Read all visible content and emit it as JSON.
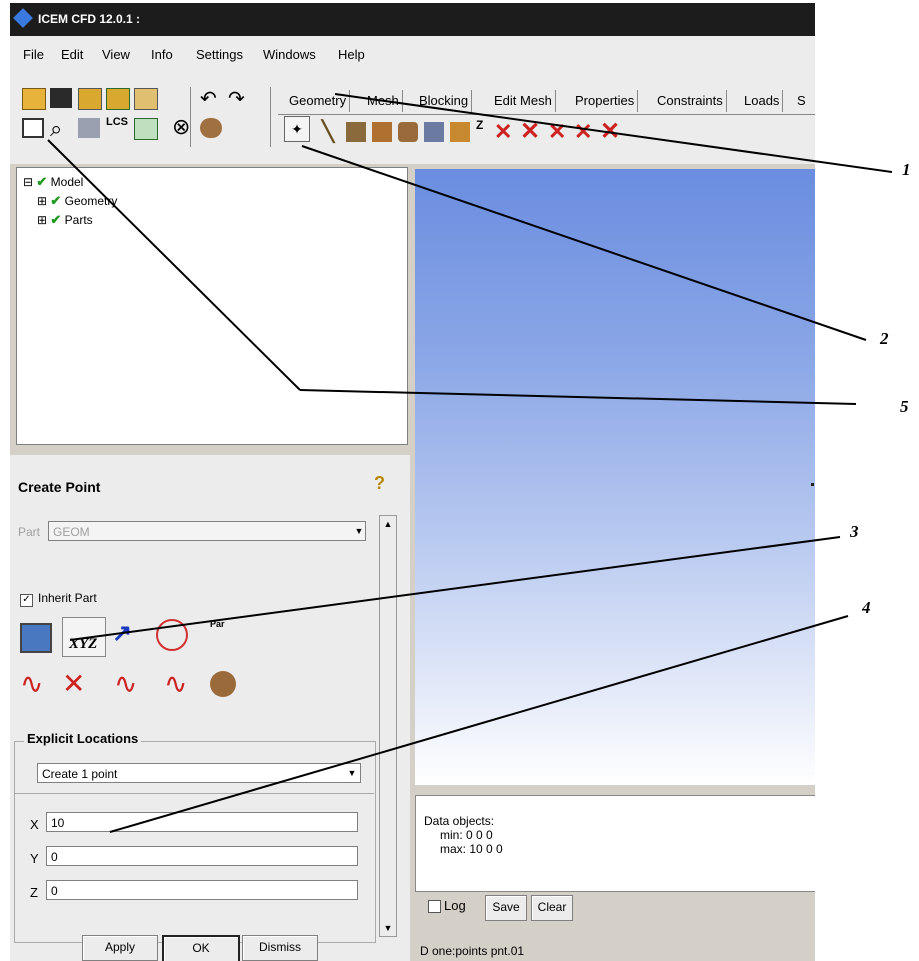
{
  "window": {
    "title": "ICEM CFD 12.0.1 :"
  },
  "menu": [
    "File",
    "Edit",
    "View",
    "Info",
    "Settings",
    "Windows",
    "Help"
  ],
  "tabs": [
    "Geometry",
    "Mesh",
    "Blocking",
    "Edit Mesh",
    "Properties",
    "Constraints",
    "Loads",
    "S"
  ],
  "tree": {
    "items": [
      "Model",
      "Geometry",
      "Parts"
    ]
  },
  "panel": {
    "title": "Create Point",
    "part_label": "Part",
    "part_value": "GEOM",
    "inherit_label": "Inherit Part",
    "xyz_label": "XYZ",
    "method_par_label": "Par",
    "explicit_label": "Explicit Locations",
    "create_option": "Create 1 point",
    "x_label": "X",
    "x_value": "10",
    "y_label": "Y",
    "y_value": "0",
    "z_label": "Z",
    "z_value": "0",
    "apply": "Apply",
    "ok": "OK",
    "dismiss": "Dismiss"
  },
  "console": {
    "line1": "Data objects:",
    "line2": "min: 0 0 0",
    "line3": "max: 10 0 0",
    "log": "Log",
    "save": "Save",
    "clear": "Clear",
    "status": "D one:points pnt.01"
  },
  "callouts": [
    "1",
    "2",
    "5",
    "3",
    "4"
  ],
  "colors": {
    "accent": "#1f9a1f",
    "delete": "#cc2222",
    "viewport_top": "#6a8de0"
  }
}
